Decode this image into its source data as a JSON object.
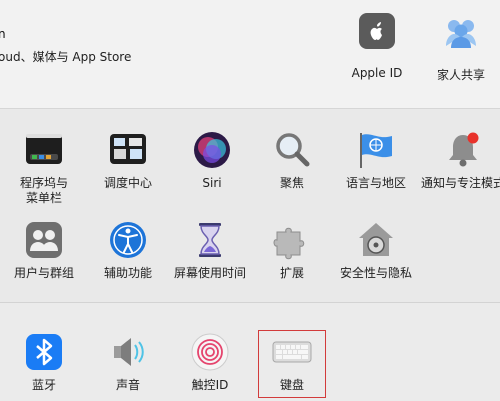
{
  "account": {
    "name_fragment": "n",
    "subtitle": "oud、媒体与 App Store"
  },
  "top_items": [
    {
      "label": "Apple ID",
      "icon": "apple-logo-icon"
    },
    {
      "label": "家人共享",
      "icon": "family-sharing-icon"
    }
  ],
  "row1": [
    {
      "label": "程序坞与\n菜单栏",
      "icon": "dock-menubar-icon"
    },
    {
      "label": "调度中心",
      "icon": "mission-control-icon"
    },
    {
      "label": "Siri",
      "icon": "siri-icon"
    },
    {
      "label": "聚焦",
      "icon": "spotlight-icon"
    },
    {
      "label": "语言与地区",
      "icon": "language-region-icon"
    },
    {
      "label": "通知与专注模式",
      "icon": "notifications-icon"
    }
  ],
  "row2": [
    {
      "label": "用户与群组",
      "icon": "users-groups-icon"
    },
    {
      "label": "辅助功能",
      "icon": "accessibility-icon"
    },
    {
      "label": "屏幕使用时间",
      "icon": "screen-time-icon"
    },
    {
      "label": "扩展",
      "icon": "extensions-icon"
    },
    {
      "label": "安全性与隐私",
      "icon": "security-privacy-icon"
    }
  ],
  "row3": [
    {
      "label": "蓝牙",
      "icon": "bluetooth-icon"
    },
    {
      "label": "声音",
      "icon": "sound-icon"
    },
    {
      "label": "触控ID",
      "icon": "touch-id-icon"
    },
    {
      "label": "键盘",
      "icon": "keyboard-icon",
      "highlight": true
    }
  ],
  "colors": {
    "highlight_border": "#d23b3b",
    "bluetooth_blue": "#1a7cf5",
    "accessibility_blue": "#1d74d8"
  }
}
